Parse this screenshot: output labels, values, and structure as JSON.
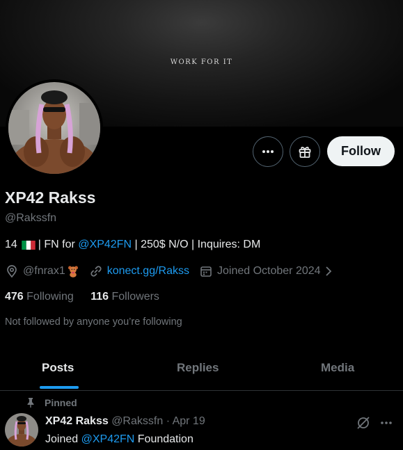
{
  "banner": {
    "text": "WORK FOR IT"
  },
  "actions": {
    "follow_label": "Follow",
    "more_icon": "more-icon",
    "gift_icon": "gift-icon"
  },
  "profile": {
    "name": "XP42 Rakss",
    "handle": "@Rakssfn",
    "bio": {
      "age": "14",
      "flag": "italy-flag",
      "part1": "| FN for",
      "mention": "@XP42FN",
      "part2": "| 250$ N/O | Inquires: DM"
    },
    "location": "@fnrax1",
    "location_emoji": "teddy-bear-emoji",
    "website": "konect.gg/Rakss",
    "joined": "Joined October 2024",
    "following_count": "476",
    "following_label": "Following",
    "followers_count": "116",
    "followers_label": "Followers",
    "not_followed_note": "Not followed by anyone you’re following"
  },
  "tabs": [
    {
      "label": "Posts",
      "active": true
    },
    {
      "label": "Replies",
      "active": false
    },
    {
      "label": "Media",
      "active": false
    }
  ],
  "pinned_post": {
    "pinned_label": "Pinned",
    "author_name": "XP42 Rakss",
    "author_handle": "@Rakssfn",
    "separator": "·",
    "date": "Apr 19",
    "text_prefix": "Joined",
    "text_mention": "@XP42FN",
    "text_suffix": "Foundation"
  },
  "colors": {
    "accent": "#1d9bf0",
    "text": "#e7e9ea",
    "muted": "#71767b",
    "background": "#000000"
  }
}
